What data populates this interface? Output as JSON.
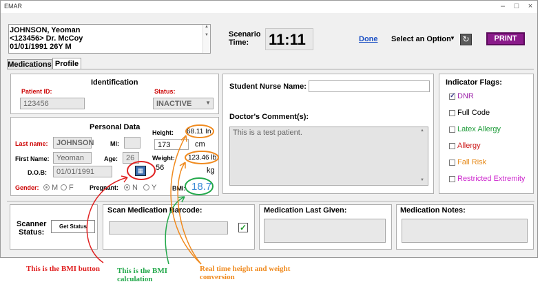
{
  "window": {
    "title": "EMAR"
  },
  "patient": {
    "line1": "JOHNSON, Yeoman",
    "line2": "<123456>   Dr. McCoy",
    "line3": "01/01/1991  26Y M"
  },
  "scenario": {
    "label_1": "Scenario",
    "label_2": "Time:",
    "time": "11:11"
  },
  "toolbar": {
    "done": "Done",
    "select_option": "Select an Option",
    "print": "PRINT"
  },
  "tabs": [
    "Medications",
    "Profile"
  ],
  "identification": {
    "heading": "Identification",
    "patient_id_label": "Patient ID:",
    "patient_id": "123456",
    "status_label": "Status:",
    "status": "INACTIVE"
  },
  "personal": {
    "heading": "Personal Data",
    "last_name_label": "Last name:",
    "last_name": "JOHNSON",
    "mi_label": "MI:",
    "mi": "",
    "first_name_label": "First Name:",
    "first_name": "Yeoman",
    "age_label": "Age:",
    "age": "26",
    "dob_label": "D.O.B:",
    "dob": "01/01/1991",
    "gender_label": "Gender:",
    "gender_m": "M",
    "gender_f": "F",
    "pregnant_label": "Pregnant:",
    "pregnant_n": "N",
    "pregnant_y": "Y",
    "height_label": "Height:",
    "height_in": "68.11 In",
    "height_cm": "173",
    "cm_unit": "cm",
    "weight_label": "Weight:",
    "weight_lb": "123.46 lb",
    "weight_kg": "56",
    "kg_unit": "kg",
    "bmi_label": "BMI:",
    "bmi": "18.7"
  },
  "notes": {
    "student_nurse_label": "Student Nurse Name:",
    "student_nurse": "",
    "doctor_comment_label": "Doctor's Comment(s):",
    "doctor_comment": "This is a test patient."
  },
  "flags": {
    "heading": "Indicator Flags:",
    "items": [
      {
        "label": "DNR",
        "color": "#9b1fa8",
        "checked": true
      },
      {
        "label": "Full Code",
        "color": "#000000",
        "checked": false
      },
      {
        "label": "Latex Allergy",
        "color": "#1f9c3a",
        "checked": false
      },
      {
        "label": "Allergy",
        "color": "#cc1a1a",
        "checked": false
      },
      {
        "label": "Fall Risk",
        "color": "#e68a1a",
        "checked": false
      },
      {
        "label": "Restricted Extremity",
        "color": "#cc22cc",
        "checked": false
      }
    ]
  },
  "bottom": {
    "scanner_label_1": "Scanner",
    "scanner_label_2": "Status:",
    "get_status": "Get Status",
    "scan_label": "Scan Medication Barcode:",
    "last_given_label": "Medication Last Given:",
    "med_notes_label": "Medication Notes:"
  },
  "annotations": {
    "bmi_button": "This is the BMI button",
    "bmi_calc_1": "This is the BMI",
    "bmi_calc_2": "calculation",
    "conversion_1": "Real time height and weight",
    "conversion_2": "conversion",
    "colors": {
      "red": "#e02020",
      "green": "#22a84a",
      "orange": "#f08a1e"
    }
  }
}
